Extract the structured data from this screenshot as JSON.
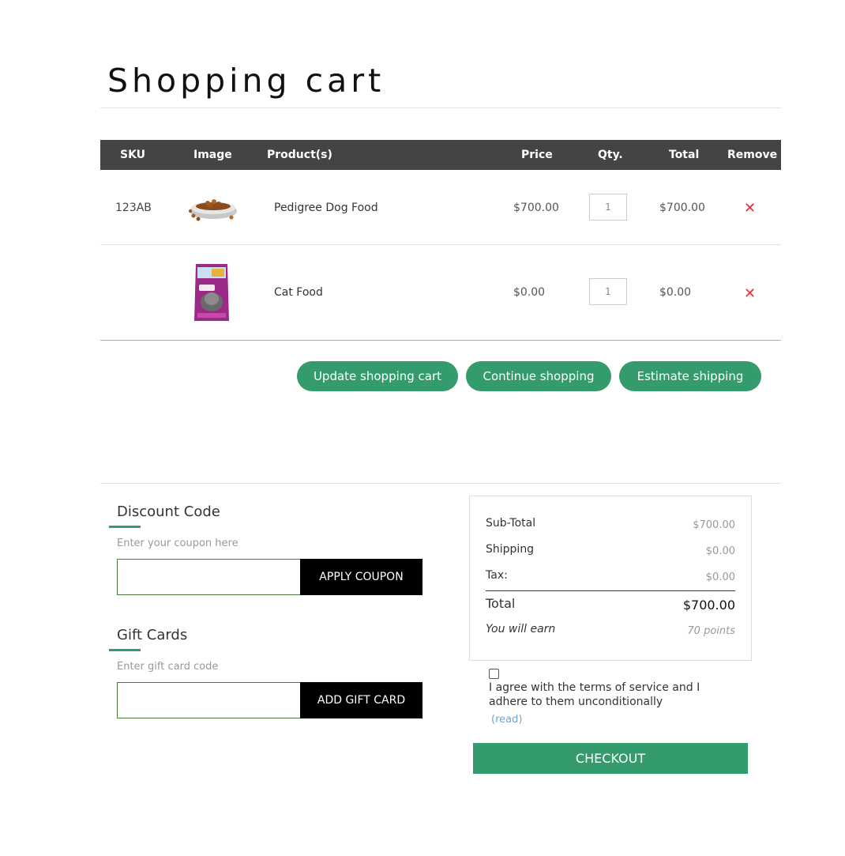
{
  "page": {
    "title": "Shopping cart"
  },
  "table": {
    "headers": {
      "sku": "SKU",
      "image": "Image",
      "product": "Product(s)",
      "price": "Price",
      "qty": "Qty.",
      "total": "Total",
      "remove": "Remove"
    },
    "rows": [
      {
        "sku": "123AB",
        "image_icon": "dog-food-bowl-image",
        "product": "Pedigree Dog Food",
        "price": "$700.00",
        "qty": "1",
        "total": "$700.00"
      },
      {
        "sku": "",
        "image_icon": "cat-food-bag-image",
        "product": "Cat Food",
        "price": "$0.00",
        "qty": "1",
        "total": "$0.00"
      }
    ]
  },
  "actions": {
    "update": "Update shopping cart",
    "continue": "Continue shopping",
    "estimate": "Estimate shipping"
  },
  "discount": {
    "title": "Discount Code",
    "hint": "Enter your coupon here",
    "button": "APPLY COUPON",
    "value": ""
  },
  "gift": {
    "title": "Gift Cards",
    "hint": "Enter gift card code",
    "button": "ADD GIFT CARD",
    "value": ""
  },
  "summary": {
    "subtotal_label": "Sub-Total",
    "subtotal_value": "$700.00",
    "shipping_label": "Shipping",
    "shipping_value": "$0.00",
    "tax_label": "Tax:",
    "tax_value": "$0.00",
    "total_label": "Total",
    "total_value": "$700.00",
    "earn_label": "You will earn",
    "earn_value": "70 points"
  },
  "terms": {
    "text": "I agree with the terms of service and I adhere to them unconditionally",
    "read_link": "(read)",
    "checked": false
  },
  "checkout": {
    "label": "CHECKOUT"
  },
  "colors": {
    "accent": "#339b6c",
    "header_bg": "#444444",
    "remove": "#e03040"
  }
}
